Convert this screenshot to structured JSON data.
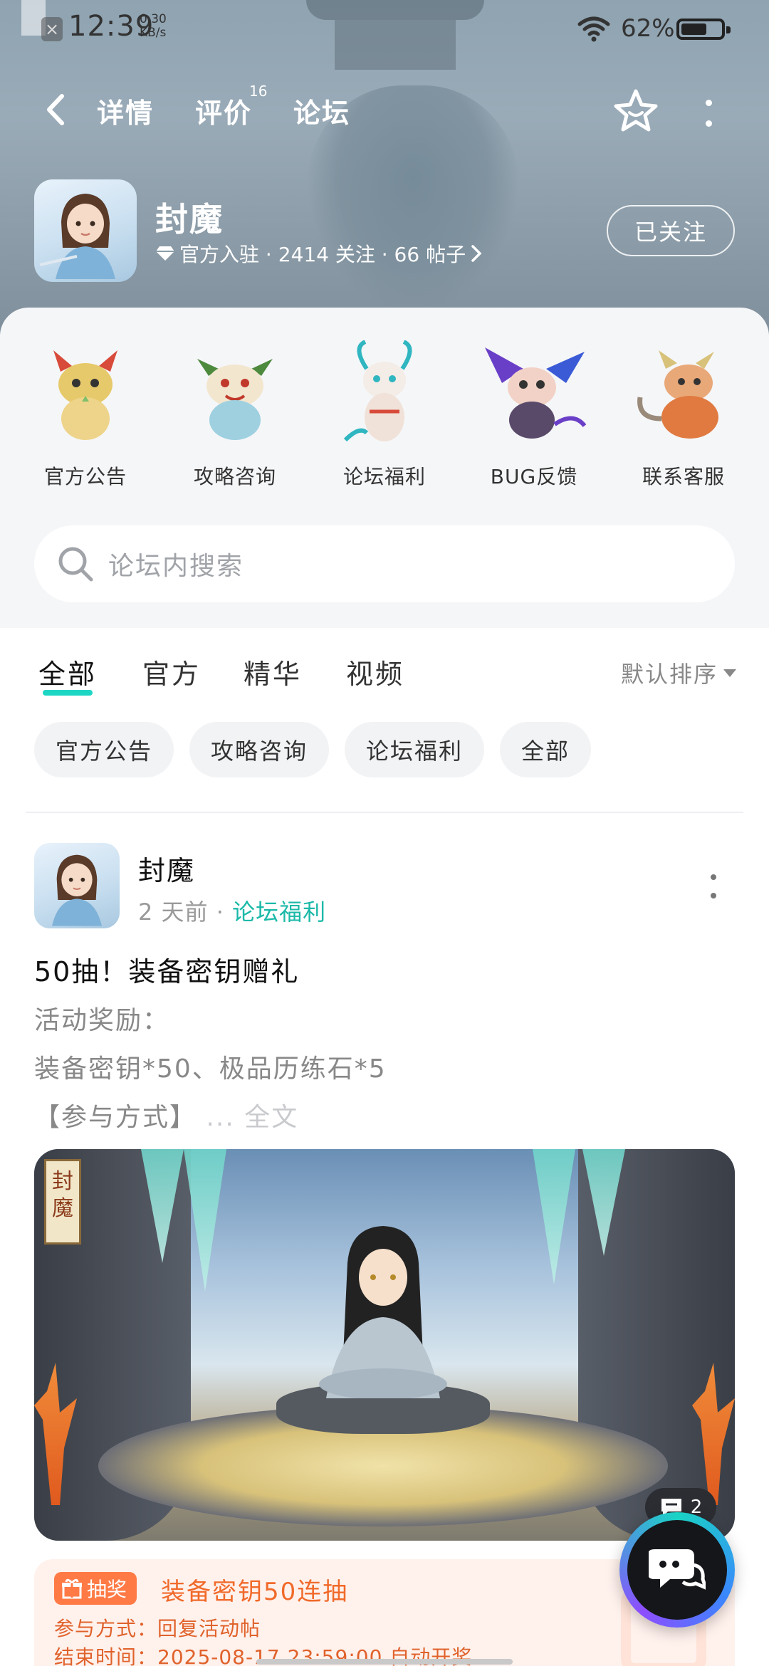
{
  "status_bar": {
    "time": "12:39",
    "net_speed_value": "0.30",
    "net_speed_unit": "KB/s",
    "battery_percent": "62%",
    "battery_level": 0.62
  },
  "nav": {
    "tabs": [
      {
        "label": "详情"
      },
      {
        "label": "评价",
        "badge": "16"
      },
      {
        "label": "论坛",
        "active": true
      }
    ]
  },
  "game": {
    "name": "封魔",
    "meta": "官方入驻 · 2414 关注 · 66 帖子",
    "follow_label": "已关注"
  },
  "shortcuts": [
    {
      "label": "官方公告",
      "color": "#e8b23a"
    },
    {
      "label": "攻略咨询",
      "color": "#7fbf6a"
    },
    {
      "label": "论坛福利",
      "color": "#5ac8d8"
    },
    {
      "label": "BUG反馈",
      "color": "#8b5bd6"
    },
    {
      "label": "联系客服",
      "color": "#e2884a"
    }
  ],
  "search": {
    "placeholder": "论坛内搜索"
  },
  "feed": {
    "tabs": [
      {
        "label": "全部",
        "active": true
      },
      {
        "label": "官方"
      },
      {
        "label": "精华"
      },
      {
        "label": "视频"
      }
    ],
    "sort_label": "默认排序",
    "chips": [
      "官方公告",
      "攻略咨询",
      "论坛福利",
      "全部"
    ]
  },
  "post": {
    "author": "封魔",
    "time": "2 天前",
    "separator": "·",
    "category": "论坛福利",
    "title": "50抽！装备密钥赠礼",
    "lines": [
      "活动奖励：",
      "装备密钥*50、极品历练石*5",
      "【参与方式】"
    ],
    "more": "... 全文",
    "image_seal": "封魔",
    "comment_count": "2",
    "lottery": {
      "tag": "抽奖",
      "title": "装备密钥50连抽",
      "method": "参与方式：回复活动帖",
      "end_time": "结束时间：2025-08-17 23:59:00 自动开奖"
    }
  },
  "colors": {
    "accent": "#1ed6c4",
    "category": "#1bb9a8",
    "lottery_orange": "#ff7a45"
  }
}
